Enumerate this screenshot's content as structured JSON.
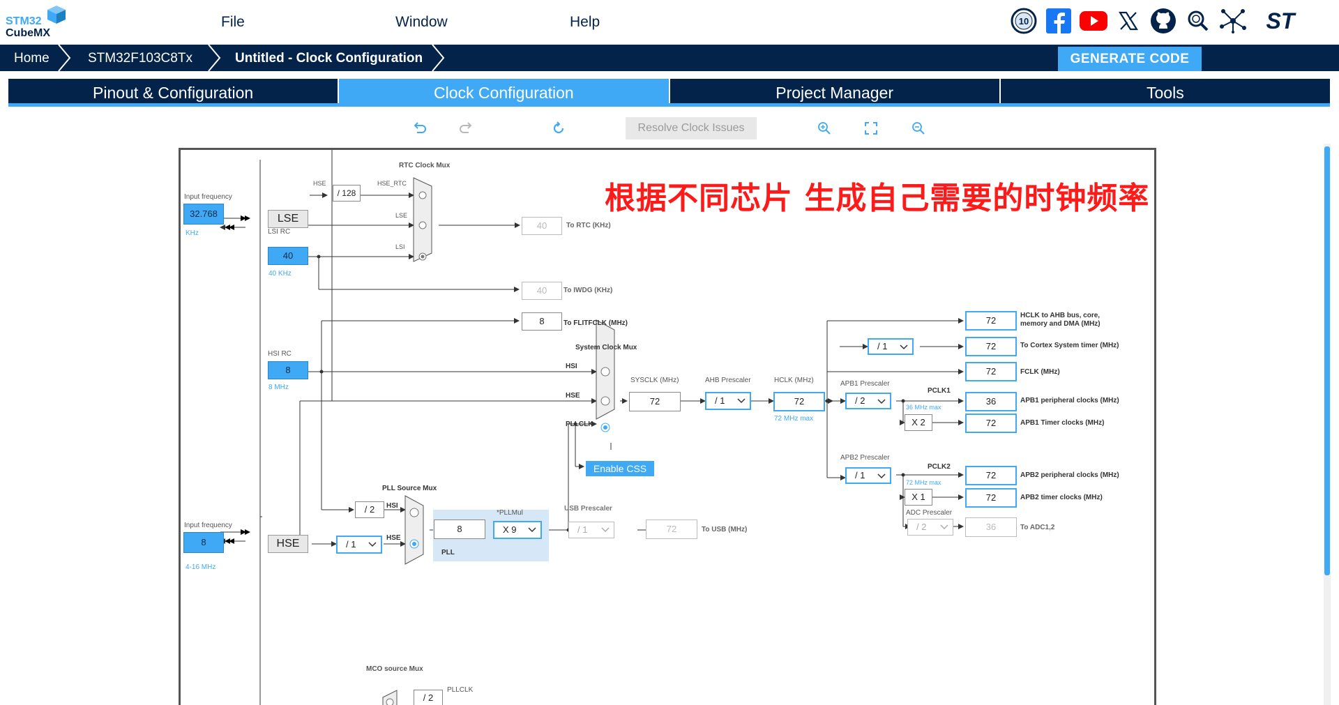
{
  "menu": {
    "file": "File",
    "window": "Window",
    "help": "Help"
  },
  "logo": {
    "line1": "STM32",
    "line2": "CubeMX"
  },
  "socials": {
    "anniversary": "10",
    "st": "ST"
  },
  "breadcrumb": {
    "home": "Home",
    "device": "STM32F103C8Tx",
    "page": "Untitled - Clock Configuration"
  },
  "generate_label": "GENERATE CODE",
  "tabs": [
    "Pinout & Configuration",
    "Clock Configuration",
    "Project Manager",
    "Tools"
  ],
  "toolbar": {
    "resolve": "Resolve Clock Issues"
  },
  "annotation": "根据不同芯片 生成自己需要的时钟频率",
  "clock": {
    "input_freq_label": "Input frequency",
    "lse_freq": "32.768",
    "lse_unit": "KHz",
    "lse": "LSE",
    "lsi_rc": "LSI RC",
    "lsi_val": "40",
    "lsi_unit": "40 KHz",
    "hsi_rc": "HSI RC",
    "hsi_val": "8",
    "hsi_unit": "8 MHz",
    "hse_freq": "8",
    "hse_unit": "4-16 MHz",
    "hse": "HSE",
    "rtc_mux": "RTC Clock Mux",
    "hse_lbl": "HSE",
    "div128": "/ 128",
    "hse_rtc": "HSE_RTC",
    "lse_lbl": "LSE",
    "lsi_lbl": "LSI",
    "rtc_val": "40",
    "rtc_out": "To RTC (KHz)",
    "iwdg_val": "40",
    "iwdg_out": "To IWDG (KHz)",
    "flit_val": "8",
    "flit_out": "To FLITFCLK (MHz)",
    "sys_mux": "System Clock Mux",
    "hsi_in": "HSI",
    "hse_in": "HSE",
    "pllclk_in": "PLLCLK",
    "enable_css": "Enable CSS",
    "sysclk_lbl": "SYSCLK (MHz)",
    "sysclk": "72",
    "ahb_lbl": "AHB Prescaler",
    "ahb": "/ 1",
    "hclk_lbl": "HCLK (MHz)",
    "hclk": "72",
    "hclk_max": "72 MHz max",
    "pll_src": "PLL Source Mux",
    "div2": "/ 2",
    "pll_hsi": "HSI",
    "pll_hse": "HSE",
    "hse_div": "/ 1",
    "pllmul_lbl": "*PLLMul",
    "pll_in": "8",
    "pllmul": "X 9",
    "pll": "PLL",
    "usb_lbl": "USB Prescaler",
    "usb": "/ 1",
    "usb_val": "72",
    "usb_out": "To USB (MHz)",
    "mco": "MCO source Mux",
    "mco_div": "/ 2",
    "mco_pll": "PLLCLK",
    "outputs": [
      {
        "val": "72",
        "label": "HCLK to AHB bus, core, memory and DMA (MHz)"
      },
      {
        "val": "72",
        "label": "To Cortex System timer (MHz)"
      },
      {
        "val": "72",
        "label": "FCLK (MHz)"
      },
      {
        "val": "36",
        "label": "APB1 peripheral clocks (MHz)"
      },
      {
        "val": "72",
        "label": "APB1 Timer clocks (MHz)"
      },
      {
        "val": "72",
        "label": "APB2 peripheral clocks (MHz)"
      },
      {
        "val": "72",
        "label": "APB2 timer clocks (MHz)"
      },
      {
        "val": "36",
        "label": "To ADC1,2"
      }
    ],
    "cortex_div": "/ 1",
    "apb1_lbl": "APB1 Prescaler",
    "apb1": "/ 2",
    "pclk1": "PCLK1",
    "pclk1_max": "36 MHz max",
    "x2": "X 2",
    "apb2_lbl": "APB2 Prescaler",
    "apb2": "/ 1",
    "pclk2": "PCLK2",
    "pclk2_max": "72 MHz max",
    "x1": "X 1",
    "adc_lbl": "ADC Prescaler",
    "adc": "/ 2"
  }
}
